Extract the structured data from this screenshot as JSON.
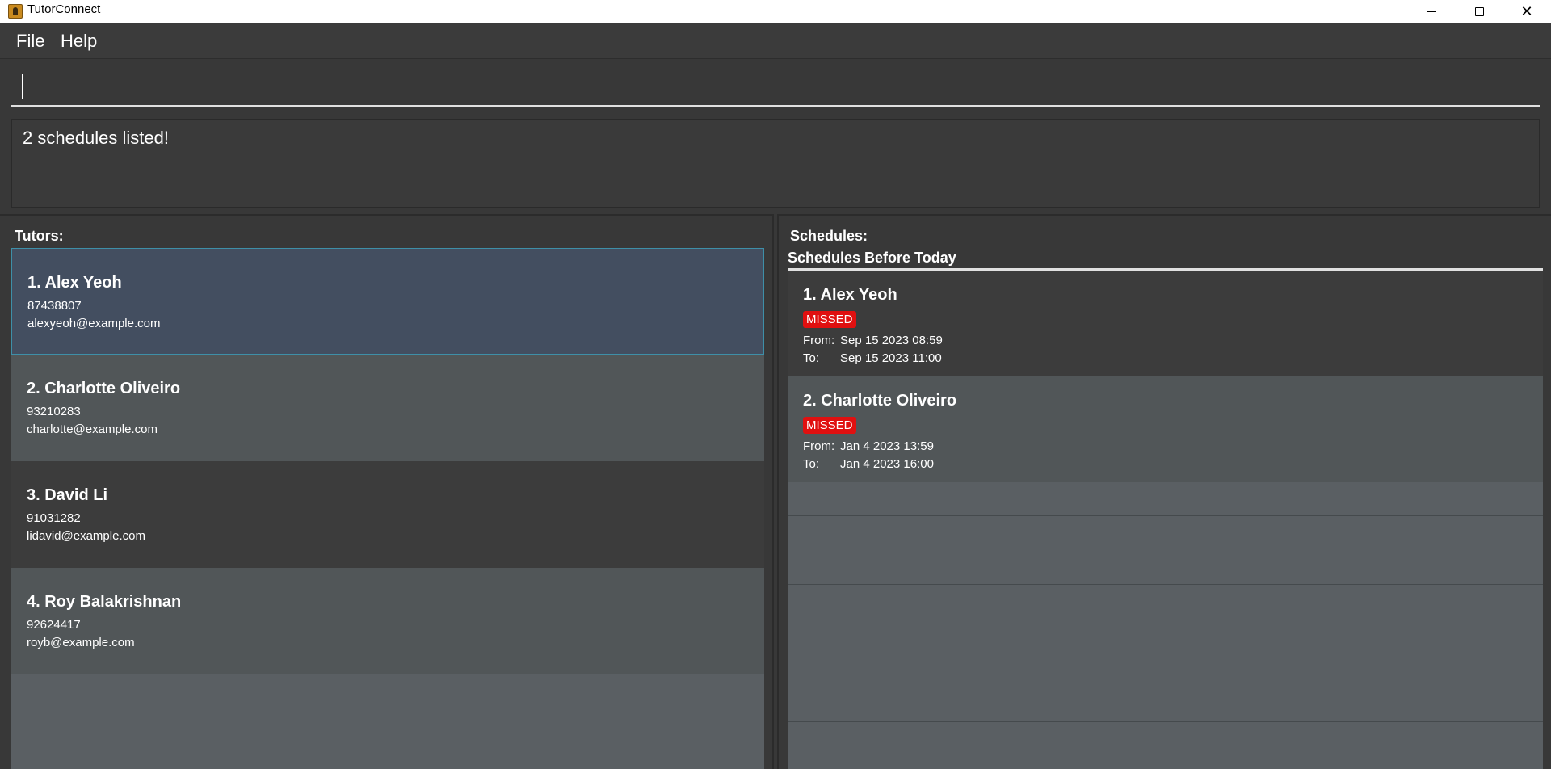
{
  "window": {
    "title": "TutorConnect",
    "icon": "app-icon",
    "controls": {
      "minimize": "minimize-icon",
      "maximize": "maximize-icon",
      "close": "close-icon"
    }
  },
  "menu": {
    "file": "File",
    "help": "Help"
  },
  "command": {
    "value": "",
    "placeholder": ""
  },
  "result": {
    "text": "2 schedules listed!"
  },
  "tutors": {
    "title": "Tutors:",
    "items": [
      {
        "name": "1.  Alex Yeoh",
        "phone": "87438807",
        "email": "alexyeoh@example.com",
        "selected": true
      },
      {
        "name": "2.  Charlotte Oliveiro",
        "phone": "93210283",
        "email": "charlotte@example.com"
      },
      {
        "name": "3.  David Li",
        "phone": "91031282",
        "email": "lidavid@example.com"
      },
      {
        "name": "4.  Roy Balakrishnan",
        "phone": "92624417",
        "email": "royb@example.com"
      }
    ]
  },
  "schedules": {
    "title": "Schedules:",
    "group_header": "Schedules Before Today",
    "from_label": "From:",
    "to_label": "To:",
    "items": [
      {
        "name": "1.  Alex Yeoh",
        "status": "MISSED",
        "from": "Sep 15 2023 08:59",
        "to": "Sep 15 2023 11:00"
      },
      {
        "name": "2.  Charlotte Oliveiro",
        "status": "MISSED",
        "from": "Jan 4 2023 13:59",
        "to": "Jan 4 2023 16:00"
      }
    ]
  },
  "colors": {
    "missed_badge": "#e01010",
    "selected_card": "#434e60",
    "selected_border": "#3e8fa8"
  }
}
